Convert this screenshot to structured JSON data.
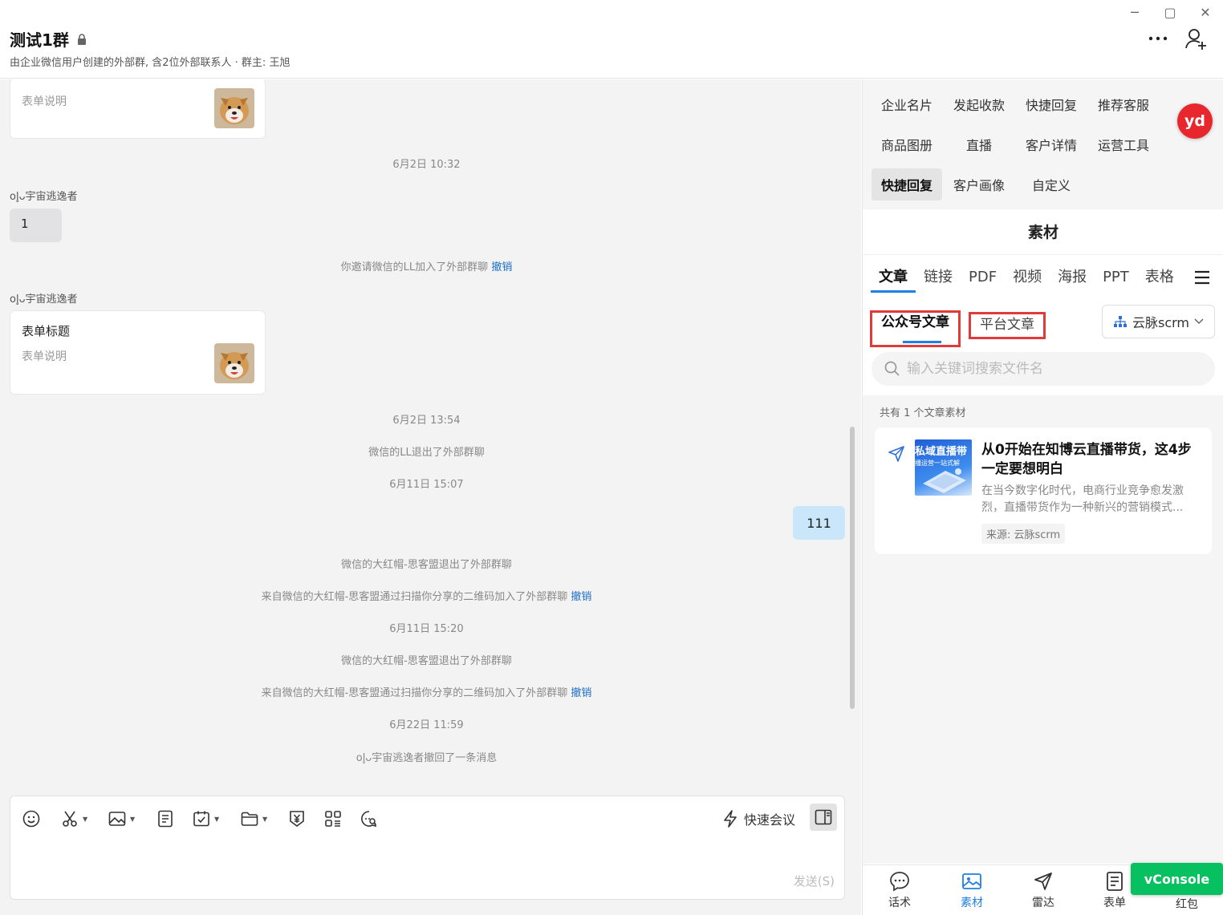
{
  "header": {
    "title": "测试1群",
    "subtitle": "由企业微信用户创建的外部群, 含2位外部联系人 · 群主: 王旭",
    "window": {
      "minimize": "─",
      "maximize": "▢",
      "close": "✕"
    }
  },
  "chat": {
    "card1": {
      "desc": "表单说明"
    },
    "ts1": "6月2日 10:32",
    "sender1": "ol̥ᴗ宇宙逃逸者",
    "msg1": "1",
    "sys1": "你邀请微信的LL加入了外部群聊",
    "sys1_action": "撤销",
    "sender2": "ol̥ᴗ宇宙逃逸者",
    "card2": {
      "title": "表单标题",
      "desc": "表单说明"
    },
    "ts2": "6月2日 13:54",
    "sys2": "微信的LL退出了外部群聊",
    "ts3": "6月11日 15:07",
    "msg2": "111",
    "sys3": "微信的大红帽-思客盟退出了外部群聊",
    "sys4": "来自微信的大红帽-思客盟通过扫描你分享的二维码加入了外部群聊",
    "sys4_action": "撤销",
    "ts4": "6月11日 15:20",
    "sys5": "微信的大红帽-思客盟退出了外部群聊",
    "sys6": "来自微信的大红帽-思客盟通过扫描你分享的二维码加入了外部群聊",
    "sys6_action": "撤销",
    "ts5": "6月22日 11:59",
    "sys7": "ol̥ᴗ宇宙逃逸者撤回了一条消息"
  },
  "composer": {
    "quick_meeting": "快速会议",
    "send": "发送(S)"
  },
  "sidebar": {
    "grid": {
      "r1": [
        "企业名片",
        "发起收款",
        "快捷回复",
        "推荐客服"
      ],
      "r2": [
        "商品图册",
        "直播",
        "客户详情",
        "运营工具"
      ],
      "r3": [
        "快捷回复",
        "客户画像",
        "自定义"
      ]
    },
    "logo": "yd",
    "material_title": "素材",
    "categories": [
      "文章",
      "链接",
      "PDF",
      "视频",
      "海报",
      "PPT",
      "表格"
    ],
    "sub_tabs": [
      "公众号文章",
      "平台文章"
    ],
    "org_select": "云脉scrm",
    "search_placeholder": "输入关键词搜索文件名",
    "count_text": "共有 1 个文章素材",
    "article": {
      "thumb_line1": "私域直播带",
      "thumb_line2": "播运营一站式解",
      "title": "从0开始在知博云直播带货，这4步一定要想明白",
      "desc": "在当今数字化时代，电商行业竞争愈发激烈，直播带货作为一种新兴的营销模式...",
      "source": "来源: 云脉scrm"
    },
    "bottom_nav": [
      "话术",
      "素材",
      "雷达",
      "表单",
      "红包"
    ],
    "vconsole": "vConsole"
  },
  "colors": {
    "accent": "#1f7fe5",
    "highlight_box": "#e03a3a",
    "vconsole": "#07c160",
    "bubble_self": "#c9e6fb"
  }
}
